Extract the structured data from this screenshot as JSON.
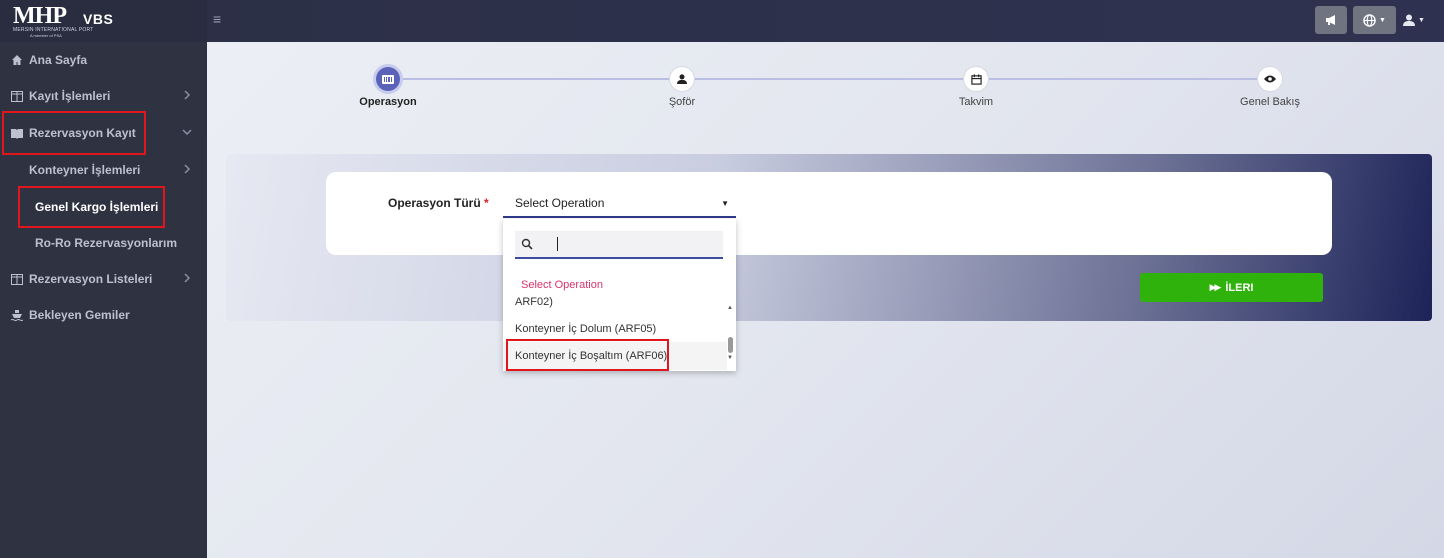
{
  "header": {
    "logo_text": "MHP",
    "logo_subtitle": "MERSIN INTERNATIONAL PORT",
    "logo_subtitle2": "A member of PSA",
    "app_name": "VBS",
    "menu_icon": "hamburger-icon",
    "buttons": {
      "announce_icon": "megaphone-icon",
      "language_icon": "globe-icon",
      "user_icon": "user-icon"
    }
  },
  "sidebar": {
    "items": [
      {
        "label": "Ana Sayfa",
        "icon": "home-icon"
      },
      {
        "label": "Kayıt İşlemleri",
        "icon": "table-icon"
      },
      {
        "label": "Rezervasyon Kayıt",
        "icon": "book-icon"
      },
      {
        "label": "Konteyner İşlemleri"
      },
      {
        "label": "Genel Kargo İşlemleri"
      },
      {
        "label": "Ro-Ro Rezervasyonlarım"
      },
      {
        "label": "Rezervasyon Listeleri",
        "icon": "table-icon"
      },
      {
        "label": "Bekleyen Gemiler",
        "icon": "ship-icon"
      }
    ]
  },
  "stepper": {
    "steps": [
      {
        "label": "Operasyon",
        "icon": "barcode-icon",
        "current": true
      },
      {
        "label": "Şoför",
        "icon": "user-icon"
      },
      {
        "label": "Takvim",
        "icon": "calendar-icon"
      },
      {
        "label": "Genel Bakış",
        "icon": "eye-icon"
      }
    ]
  },
  "form": {
    "operation_label": "Operasyon Türü",
    "required_mark": "*",
    "select_value": "Select Operation",
    "dropdown": {
      "search_value": "",
      "placeholder_option": "Select Operation",
      "options": [
        "ARF02)",
        "Konteyner İç Dolum (ARF05)",
        "Konteyner İç Boşaltım (ARF06)"
      ]
    }
  },
  "next_button": {
    "label": "İLERI",
    "icon": "fast-forward-icon"
  },
  "colors": {
    "accent": "#5a63b8",
    "highlight": "#e0161c",
    "next": "#2fb30c"
  }
}
